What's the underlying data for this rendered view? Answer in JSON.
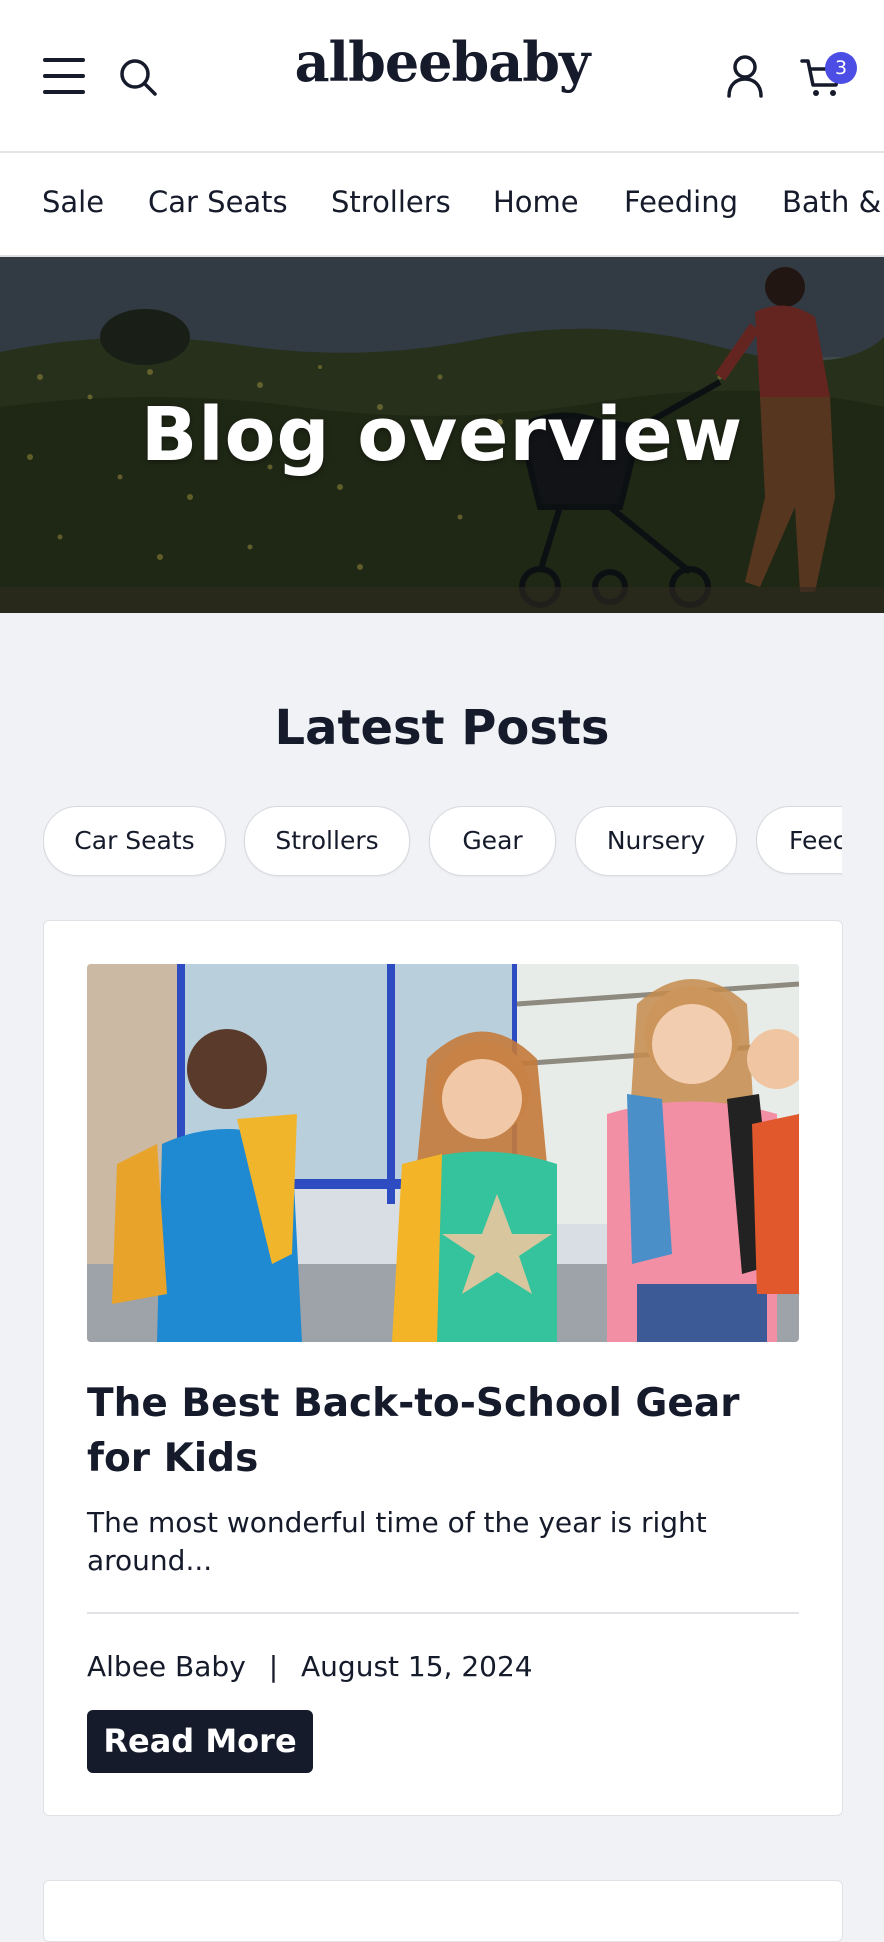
{
  "header": {
    "logo": "albeebaby",
    "cart_count": "3",
    "icons": [
      "menu-icon",
      "search-icon",
      "account-icon",
      "cart-icon"
    ]
  },
  "nav": {
    "categories": [
      "Sale",
      "Car Seats",
      "Strollers",
      "Home",
      "Feeding",
      "Bath &"
    ]
  },
  "hero": {
    "title": "Blog overview"
  },
  "latest": {
    "title": "Latest Posts",
    "filters": [
      "Car Seats",
      "Strollers",
      "Gear",
      "Nursery",
      "Feec"
    ]
  },
  "post": {
    "title": "The Best Back-to-School Gear for Kids",
    "excerpt": "The most wonderful time of the year is right around...",
    "author": "Albee Baby",
    "separator": "|",
    "date": "August 15, 2024",
    "cta": "Read More"
  },
  "colors": {
    "brand_dark": "#161b2b",
    "badge": "#4b4de4",
    "page_bg": "#f1f2f6"
  }
}
